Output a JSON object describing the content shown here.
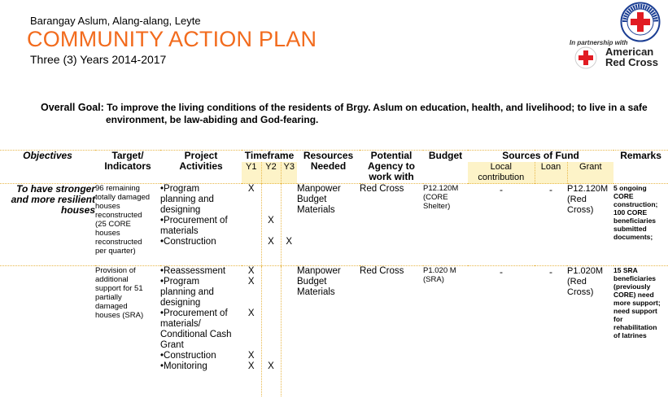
{
  "header": {
    "location": "Barangay Aslum, Alang-alang, Leyte",
    "title": "COMMUNITY ACTION PLAN",
    "years": "Three (3) Years 2014-2017",
    "partnership": "In partnership with",
    "arc_line1": "American",
    "arc_line2": "Red Cross",
    "prc_text": "PHILIPPINE RED CROSS",
    "colors": {
      "title": "#f26b1d",
      "red": "#e11b22",
      "accent_border": "#e8b84a",
      "subheader_bg": "#fdf3c8"
    }
  },
  "goal": {
    "label": "Overall Goal:",
    "text1": "To improve the living conditions of the residents of Brgy. Aslum on education, health, and livelihood; to live in a safe",
    "text2": "environment, be law-abiding and God-fearing."
  },
  "columns": {
    "objectives": "Objectives",
    "target1": "Target/",
    "target2": "Indicators",
    "project1": "Project",
    "project2": "Activities",
    "timeframe": "Timeframe",
    "y1": "Y1",
    "y2": "Y2",
    "y3": "Y3",
    "resources1": "Resources",
    "resources2": "Needed",
    "agency1": "Potential",
    "agency2": "Agency to",
    "agency3": "work with",
    "budget": "Budget",
    "sources": "Sources of Fund",
    "local1": "Local",
    "local2": "contribution",
    "loan": "Loan",
    "grant": "Grant",
    "remarks": "Remarks"
  },
  "rows": [
    {
      "objective1": "To have stronger",
      "objective2": "and more resilient",
      "objective3": "houses",
      "target": [
        "96 remaining",
        "totally damaged",
        "houses",
        "reconstructed",
        "(25 CORE",
        "houses",
        "reconstructed",
        "per quarter)"
      ],
      "activities": [
        "•Program",
        "planning and",
        "designing",
        "•Procurement of",
        "materials",
        "•Construction"
      ],
      "y1": [
        "X",
        "",
        "",
        "",
        "",
        ""
      ],
      "y2": [
        "",
        "",
        "",
        "X",
        "",
        "X"
      ],
      "y3": [
        "",
        "",
        "",
        "",
        "",
        "X"
      ],
      "resources": [
        "Manpower",
        "Budget",
        "Materials"
      ],
      "agency": "Red Cross",
      "budget": [
        "P12.120M",
        "(CORE",
        "Shelter)"
      ],
      "local": "-",
      "loan": "-",
      "grant": [
        "P12.120M",
        "(Red",
        "Cross)"
      ],
      "remarks": [
        "5 ongoing",
        "CORE",
        "construction;",
        "100 CORE",
        "beneficiaries",
        "submitted",
        "documents;"
      ]
    },
    {
      "target": [
        "Provision of",
        "additional",
        "support for 51",
        "partially",
        "damaged",
        "houses (SRA)"
      ],
      "activities": [
        "•Reassessment",
        "•Program",
        "planning and",
        "designing",
        "•Procurement of",
        "materials/",
        "Conditional Cash",
        "Grant",
        "•Construction",
        "•Monitoring"
      ],
      "y1": [
        "X",
        "X",
        "",
        "",
        "X",
        "",
        "",
        "",
        "X",
        "X"
      ],
      "y2": [
        "",
        "",
        "",
        "",
        "",
        "",
        "",
        "",
        "",
        "X"
      ],
      "y3": [
        "",
        "",
        "",
        "",
        "",
        "",
        "",
        "",
        "",
        ""
      ],
      "resources": [
        "Manpower",
        "Budget",
        "Materials"
      ],
      "agency": "Red Cross",
      "budget": [
        "P1.020 M",
        "(SRA)"
      ],
      "local": "-",
      "loan": "-",
      "grant": [
        "P1.020M",
        "(Red",
        "Cross)"
      ],
      "remarks": [
        "15 SRA",
        "beneficiaries",
        "(previously",
        "CORE) need",
        "more support;",
        "need support",
        "for",
        "rehabilitation",
        "of latrines"
      ]
    }
  ]
}
